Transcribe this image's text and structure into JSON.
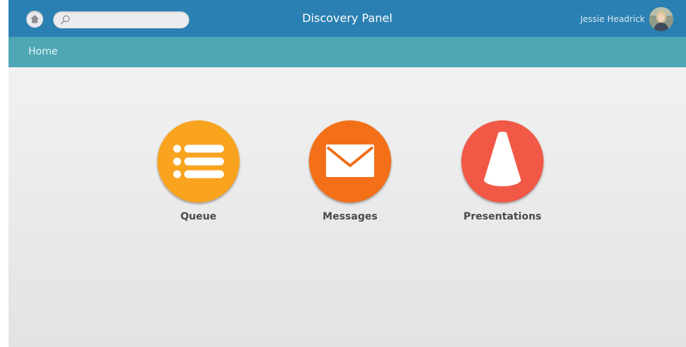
{
  "header": {
    "title": "Discovery Panel",
    "search_placeholder": "",
    "user_name": "Jessie Headrick"
  },
  "breadcrumb": {
    "label": "Home"
  },
  "tiles": [
    {
      "label": "Queue",
      "icon": "list-icon",
      "color": "#f9a31e"
    },
    {
      "label": "Messages",
      "icon": "envelope-icon",
      "color": "#f37018"
    },
    {
      "label": "Presentations",
      "icon": "spotlight-icon",
      "color": "#f25846"
    }
  ],
  "colors": {
    "topbar": "#2a80b2",
    "navbar": "#4fa7b5",
    "background": "#ececec"
  }
}
